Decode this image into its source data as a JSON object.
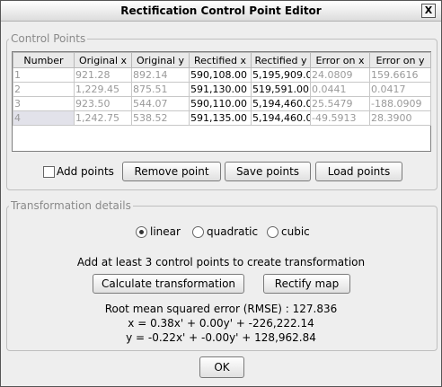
{
  "window": {
    "title": "Rectification Control Point Editor",
    "close_glyph": "X"
  },
  "control_points": {
    "legend": "Control Points",
    "columns": [
      "Number",
      "Original x",
      "Original y",
      "Rectified x",
      "Rectified y",
      "Error on x",
      "Error on y"
    ],
    "rows": [
      [
        "1",
        "921.28",
        "892.14",
        "590,108.00",
        "5,195,909.0",
        "24.0809",
        "159.6616"
      ],
      [
        "2",
        "1,229.45",
        "875.51",
        "591,130.00",
        "519,591.00",
        "0.0441",
        "0.0417"
      ],
      [
        "3",
        "923.50",
        "544.07",
        "590,110.00",
        "5,194,460.0",
        "25.5479",
        "-188.0909"
      ],
      [
        "4",
        "1,242.75",
        "538.52",
        "591,135.00",
        "5,194,460.0",
        "-49.5913",
        "28.3900"
      ]
    ],
    "add_points_label": "Add points",
    "remove_point_label": "Remove point",
    "save_points_label": "Save points",
    "load_points_label": "Load points"
  },
  "transformation": {
    "legend": "Transformation details",
    "options": [
      "linear",
      "quadratic",
      "cubic"
    ],
    "selected": "linear",
    "hint": "Add at least 3 control points to create transformation",
    "calculate_label": "Calculate transformation",
    "rectify_label": "Rectify map",
    "rmse": "Root mean squared error (RMSE) : 127.836",
    "eq_x": "x = 0.38x' + 0.00y' + -226,222.14",
    "eq_y": "y = -0.22x' + -0.00y' + 128,962.84"
  },
  "ok_label": "OK"
}
